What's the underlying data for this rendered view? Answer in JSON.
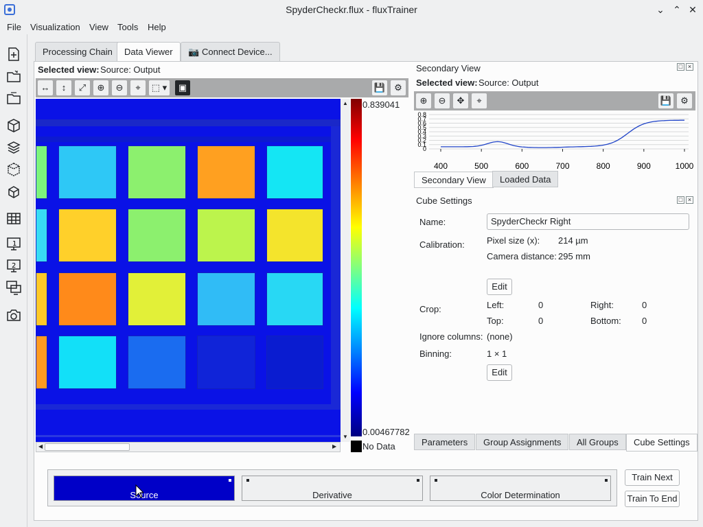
{
  "window": {
    "title": "SpyderCheckr.flux - fluxTrainer"
  },
  "menu": [
    "File",
    "Visualization",
    "View",
    "Tools",
    "Help"
  ],
  "tabs": [
    "Processing Chain",
    "Data Viewer",
    "Connect Device..."
  ],
  "main": {
    "selected_label": "Selected view:",
    "selected_value": "Source: Output"
  },
  "colorbar": {
    "max": "0.839041",
    "min": "0.00467782",
    "nodata": "No Data"
  },
  "secondary": {
    "title": "Secondary View",
    "selected_label": "Selected view:",
    "selected_value": "Source: Output",
    "y_ticks": [
      "0.8",
      "0.7",
      "0.6",
      "0.5",
      "0.4",
      "0.3",
      "0.2",
      "0.1",
      "0"
    ],
    "x_ticks": [
      "400",
      "500",
      "600",
      "700",
      "800",
      "900",
      "1000"
    ],
    "tabs": [
      "Secondary View",
      "Loaded Data"
    ]
  },
  "cube": {
    "title": "Cube Settings",
    "name_label": "Name:",
    "name_value": "SpyderCheckr Right",
    "calibration_label": "Calibration:",
    "pixel_size_label": "Pixel size (x):",
    "pixel_size_value": "214 µm",
    "camera_distance_label": "Camera distance:",
    "camera_distance_value": "295 mm",
    "edit_label": "Edit",
    "crop_label": "Crop:",
    "left_label": "Left:",
    "left_value": "0",
    "right_label": "Right:",
    "right_value": "0",
    "top_label": "Top:",
    "top_value": "0",
    "bottom_label": "Bottom:",
    "bottom_value": "0",
    "ignore_label": "Ignore columns:",
    "ignore_value": "(none)",
    "binning_label": "Binning:",
    "binning_value": "1  ×  1",
    "edit2_label": "Edit"
  },
  "settings_tabs": [
    "Parameters",
    "Group Assignments",
    "All Groups",
    "Cube Settings"
  ],
  "chain": {
    "steps": [
      "Source",
      "Derivative",
      "Color Determination"
    ],
    "train_next": "Train Next",
    "train_end": "Train To End"
  },
  "colors": {
    "accent": "#0000c8",
    "image_bg": "#0a12e6"
  }
}
